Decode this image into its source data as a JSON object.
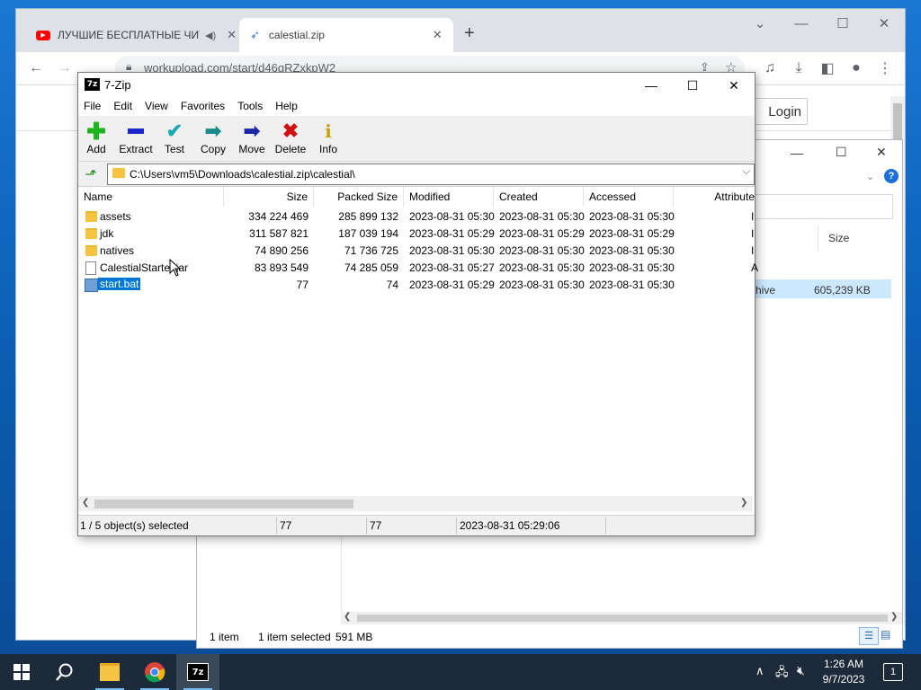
{
  "browser": {
    "tabs": [
      {
        "title": "ЛУЧШИЕ БЕСПЛАТНЫЕ ЧИТ",
        "icon": "youtube-icon",
        "audio": true
      },
      {
        "title": "calestial.zip",
        "icon": "rocket-icon"
      }
    ],
    "url": "workupload.com/start/d46gRZxkpW2",
    "page": {
      "login_label": "Login"
    }
  },
  "explorer": {
    "column_size": "Size",
    "row_type": "hive",
    "row_size": "605,239 KB",
    "status": {
      "items": "1 item",
      "selected": "1 item selected",
      "size": "591 MB"
    }
  },
  "sevenzip": {
    "title": "7-Zip",
    "logo": "7z",
    "menu": [
      "File",
      "Edit",
      "View",
      "Favorites",
      "Tools",
      "Help"
    ],
    "toolbar": [
      {
        "label": "Add",
        "icon": "plus-icon",
        "color": "#1db31d"
      },
      {
        "label": "Extract",
        "icon": "minus-icon",
        "color": "#1a27c9"
      },
      {
        "label": "Test",
        "icon": "check-icon",
        "color": "#1aaab0"
      },
      {
        "label": "Copy",
        "icon": "copy-arrow-icon",
        "color": "#1a8a8a"
      },
      {
        "label": "Move",
        "icon": "move-arrow-icon",
        "color": "#1a27a8"
      },
      {
        "label": "Delete",
        "icon": "delete-x-icon",
        "color": "#d01010"
      },
      {
        "label": "Info",
        "icon": "info-icon",
        "color": "#c8a000"
      }
    ],
    "address": "C:\\Users\\vm5\\Downloads\\calestial.zip\\calestial\\",
    "columns": [
      "Name",
      "Size",
      "Packed Size",
      "Modified",
      "Created",
      "Accessed",
      "Attribute"
    ],
    "files": [
      {
        "name": "assets",
        "type": "folder",
        "size": "334 224 469",
        "packed": "285 899 132",
        "modified": "2023-08-31 05:30",
        "created": "2023-08-31 05:30",
        "accessed": "2023-08-31 05:30",
        "attr": "I"
      },
      {
        "name": "jdk",
        "type": "folder",
        "size": "311 587 821",
        "packed": "187 039 194",
        "modified": "2023-08-31 05:29",
        "created": "2023-08-31 05:29",
        "accessed": "2023-08-31 05:29",
        "attr": "I"
      },
      {
        "name": "natives",
        "type": "folder",
        "size": "74 890 256",
        "packed": "71 736 725",
        "modified": "2023-08-31 05:30",
        "created": "2023-08-31 05:30",
        "accessed": "2023-08-31 05:30",
        "attr": "I"
      },
      {
        "name": "CalestialStarter.jar",
        "type": "file",
        "size": "83 893 549",
        "packed": "74 285 059",
        "modified": "2023-08-31 05:27",
        "created": "2023-08-31 05:30",
        "accessed": "2023-08-31 05:30",
        "attr": "A"
      },
      {
        "name": "start.bat",
        "type": "bat",
        "size": "77",
        "packed": "74",
        "modified": "2023-08-31 05:29",
        "created": "2023-08-31 05:30",
        "accessed": "2023-08-31 05:30",
        "attr": "",
        "selected": true
      }
    ],
    "status": {
      "selected": "1 / 5 object(s) selected",
      "size": "77",
      "packed": "77",
      "modified": "2023-08-31 05:29:06"
    }
  },
  "taskbar": {
    "time": "1:26 AM",
    "date": "9/7/2023",
    "notifications": "1"
  }
}
